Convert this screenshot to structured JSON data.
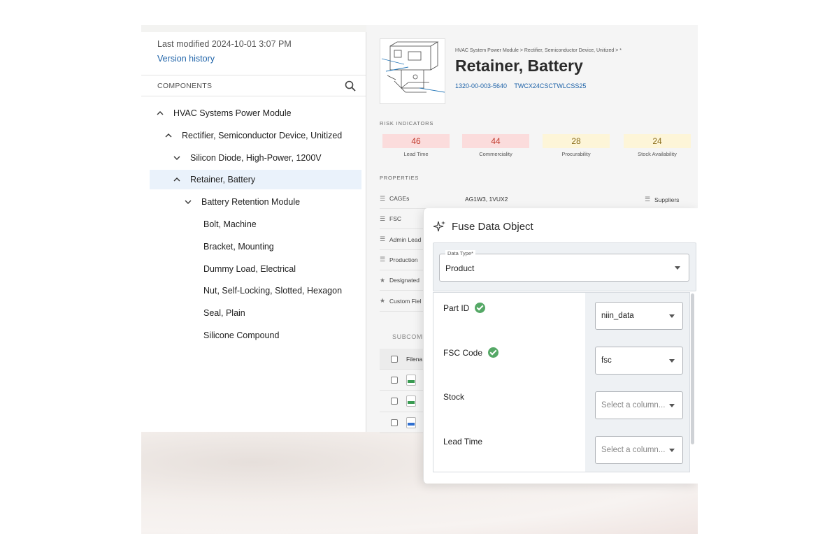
{
  "left_panel": {
    "last_modified": "Last modified 2024-10-01 3:07 PM",
    "version_history": "Version history",
    "components_header": "COMPONENTS",
    "tree": [
      {
        "label": "HVAC Systems Power Module",
        "chevron": "up"
      },
      {
        "label": "Rectifier, Semiconductor Device, Unitized",
        "chevron": "up"
      },
      {
        "label": "Silicon Diode, High-Power, 1200V",
        "chevron": "down"
      },
      {
        "label": "Retainer, Battery",
        "chevron": "up",
        "selected": true
      },
      {
        "label": "Battery Retention Module",
        "chevron": "down"
      },
      {
        "label": "Bolt, Machine"
      },
      {
        "label": "Bracket, Mounting"
      },
      {
        "label": "Dummy Load, Electrical"
      },
      {
        "label": "Nut, Self-Locking, Slotted, Hexagon"
      },
      {
        "label": "Seal, Plain"
      },
      {
        "label": "Silicone Compound"
      }
    ]
  },
  "detail": {
    "breadcrumb": "HVAC System Power Module > Rectifier, Semiconductor Device, Unitized > *",
    "title": "Retainer, Battery",
    "id_1": "1320-00-003-5640",
    "id_2": "TWCX24CSCTWLCSS25",
    "risk_header": "RISK INDICATORS",
    "risks": [
      {
        "value": "46",
        "label": "Lead Time",
        "bg": "#fbdcdc",
        "color": "#c0392b"
      },
      {
        "value": "44",
        "label": "Commerciality",
        "bg": "#fbdcdc",
        "color": "#c0392b"
      },
      {
        "value": "28",
        "label": "Procurability",
        "bg": "#fdf5d8",
        "color": "#8a6d1a"
      },
      {
        "value": "24",
        "label": "Stock Availability",
        "bg": "#fdf5d8",
        "color": "#8a6d1a"
      }
    ],
    "properties_header": "PROPERTIES",
    "properties": [
      {
        "label": "CAGEs",
        "icon": "list-icon"
      },
      {
        "label": "FSC",
        "icon": "list-icon"
      },
      {
        "label": "Admin Lead",
        "icon": "list-icon"
      },
      {
        "label": "Production",
        "icon": "list-icon"
      },
      {
        "label": "Designated",
        "icon": "star-icon"
      },
      {
        "label": "Custom Fiel",
        "icon": "star-icon"
      }
    ],
    "cages_value": "AG1W3, 1VUX2",
    "suppliers_label": "Suppliers",
    "subcomponents_header": "SUBCOMP",
    "files_header": "Filena",
    "files": [
      {
        "type": "csv",
        "color": "#3a9b52"
      },
      {
        "type": "csv",
        "color": "#3a9b52"
      },
      {
        "type": "docx",
        "color": "#2f6fd0"
      }
    ]
  },
  "dialog": {
    "title": "Fuse Data Object",
    "data_type_label": "Data Type*",
    "data_type_value": "Product",
    "rows": [
      {
        "name": "Part ID",
        "checked": true,
        "value": "niin_data",
        "placeholder": false
      },
      {
        "name": "FSC Code",
        "checked": true,
        "value": "fsc",
        "placeholder": false
      },
      {
        "name": "Stock",
        "checked": false,
        "value": "Select a column...",
        "placeholder": true
      },
      {
        "name": "Lead Time",
        "checked": false,
        "value": "Select a column...",
        "placeholder": true
      }
    ]
  }
}
